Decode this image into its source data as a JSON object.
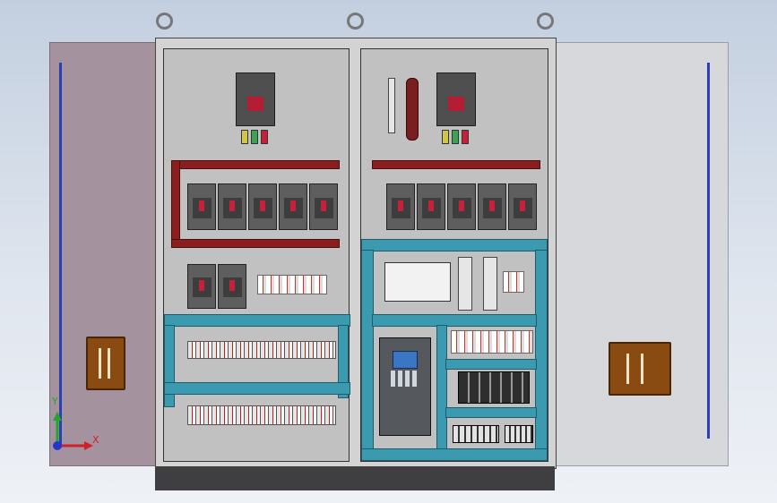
{
  "viewport": {
    "background_top": "#c3cfe0",
    "background_bottom": "#eef1f6"
  },
  "colors": {
    "left_door": "#a5929f",
    "right_door": "#d6d8db",
    "cabinet_frame": "#d3d3d3",
    "mounting_plate": "#c1c1c1",
    "busbar": "#8b1e1e",
    "wire_duct": "#3b9aaf",
    "door_rod": "#2c3fb3",
    "handle": "#8a4b12",
    "plinth": "#3f3f42",
    "axis_x": "#d0202a",
    "axis_y": "#22a52c",
    "axis_z": "#2437c8"
  },
  "axis_triad": {
    "x_label": "X",
    "y_label": "Y"
  },
  "icons": {
    "eyebolt": "lifting-eyebolt-icon",
    "handle": "door-handle-icon",
    "breaker": "circuit-breaker-icon",
    "vfd": "variable-frequency-drive-icon",
    "plc": "plc-module-icon"
  }
}
